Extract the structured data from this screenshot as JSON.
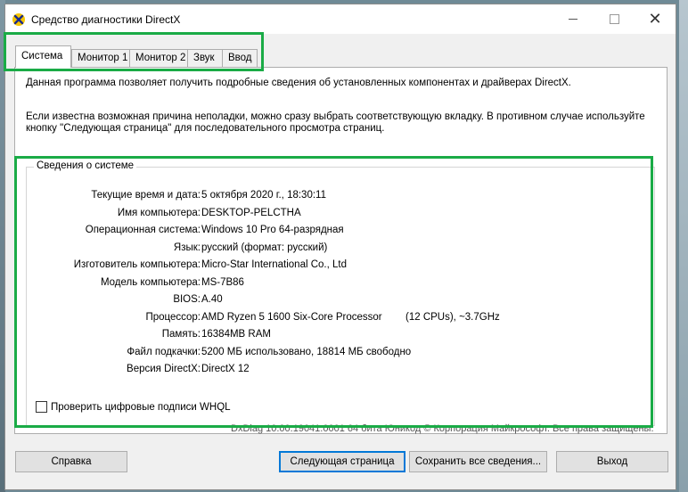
{
  "window": {
    "title": "Средство диагностики DirectX"
  },
  "tabs": [
    {
      "label": "Система",
      "active": true
    },
    {
      "label": "Монитор 1",
      "active": false
    },
    {
      "label": "Монитор 2",
      "active": false
    },
    {
      "label": "Звук",
      "active": false
    },
    {
      "label": "Ввод",
      "active": false
    }
  ],
  "intro": {
    "line1": "Данная программа позволяет получить подробные сведения об установленных компонентах и драйверах DirectX.",
    "line2": "Если известна возможная причина неполадки, можно сразу выбрать соответствующую вкладку. В противном случае используйте кнопку \"Следующая страница\" для последовательного просмотра страниц."
  },
  "system_info": {
    "group_title": "Сведения о системе",
    "rows": [
      {
        "label": "Текущие время и дата:",
        "value": "5 октября 2020 г., 18:30:11"
      },
      {
        "label": "Имя компьютера:",
        "value": "DESKTOP-PELCTHA"
      },
      {
        "label": "Операционная система:",
        "value": "Windows 10 Pro 64-разрядная"
      },
      {
        "label": "Язык:",
        "value": "русский (формат: русский)"
      },
      {
        "label": "Изготовитель компьютера:",
        "value": "Micro-Star International Co., Ltd"
      },
      {
        "label": "Модель компьютера:",
        "value": "MS-7B86"
      },
      {
        "label": "BIOS:",
        "value": "A.40"
      },
      {
        "label": "Процессор:",
        "value": "AMD Ryzen 5 1600 Six-Core Processor"
      },
      {
        "label": "Память:",
        "value": "16384MB RAM"
      },
      {
        "label": "Файл подкачки:",
        "value": "5200 МБ использовано, 18814 МБ свободно"
      },
      {
        "label": "Версия DirectX:",
        "value": "DirectX 12"
      }
    ],
    "processor_extra": "(12 CPUs), ~3.7GHz",
    "whql_label": "Проверить цифровые подписи WHQL",
    "whql_checked": false
  },
  "footer_text": "DxDiag 10.00.19041.0001 64 бита Юникод © Корпорация Майкрософт. Все права защищены.",
  "buttons": {
    "help": "Справка",
    "next": "Следующая страница",
    "save": "Сохранить все сведения...",
    "exit": "Выход"
  },
  "colors": {
    "highlight": "#1aab46",
    "default_button_border": "#0078d7"
  }
}
